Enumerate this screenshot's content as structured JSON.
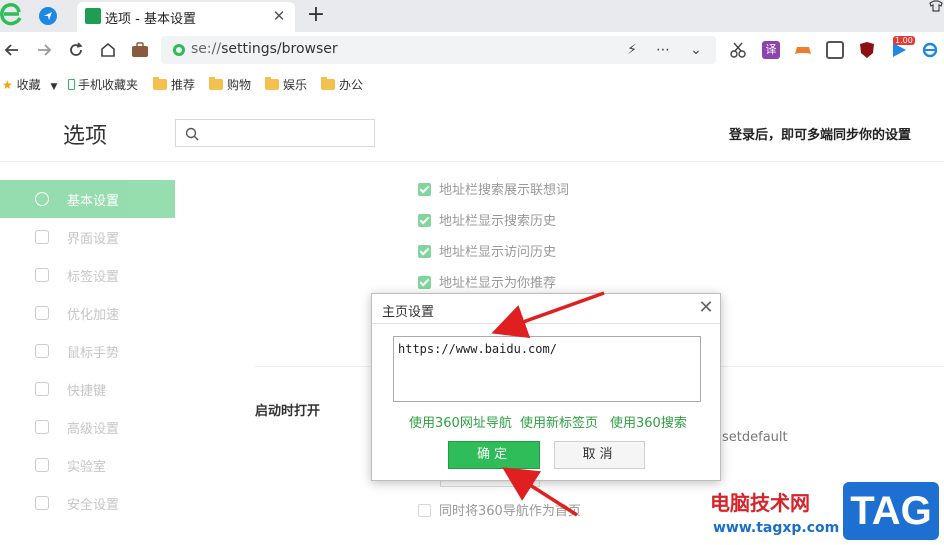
{
  "browser": {
    "tab_title": "选项 - 基本设置",
    "tab_close": "✕",
    "new_tab": "+",
    "url_scheme": "se://",
    "url_path": "settings/browser",
    "omnibox_icons": [
      "lightning-icon",
      "more-icon",
      "chevron-down-icon"
    ],
    "extensions": [
      "scissors-icon",
      "translate-icon",
      "gamepad-icon",
      "reader-icon",
      "ublock-icon",
      "play-icon",
      "ie-icon"
    ],
    "badge": "1.00"
  },
  "bookmarks": {
    "favorites": "收藏",
    "mobile": "手机收藏夹",
    "folders": [
      "推荐",
      "购物",
      "娱乐",
      "办公"
    ]
  },
  "settings": {
    "title": "选项",
    "search_placeholder": "",
    "sync_text": "登录后，即可多端同步你的设置",
    "sidebar": [
      {
        "label": "基本设置",
        "active": true
      },
      {
        "label": "界面设置"
      },
      {
        "label": "标签设置"
      },
      {
        "label": "优化加速"
      },
      {
        "label": "鼠标手势"
      },
      {
        "label": "快捷键"
      },
      {
        "label": "高级设置"
      },
      {
        "label": "实验室"
      },
      {
        "label": "安全设置"
      }
    ],
    "options": [
      {
        "label": "地址栏搜索展示联想词",
        "checked": true
      },
      {
        "label": "地址栏显示搜索历史",
        "checked": true
      },
      {
        "label": "地址栏显示访问历史",
        "checked": true
      },
      {
        "label": "地址栏显示为你推荐",
        "checked": true
      }
    ],
    "startup_section": "启动时打开",
    "frag_text": "setdefault",
    "bottom_option": "同时将360导航作为首页"
  },
  "dialog": {
    "title": "主页设置",
    "close": "✕",
    "url_value": "https://www.baidu.com/",
    "links": [
      "使用360网址导航",
      "使用新标签页",
      "使用360搜索"
    ],
    "ok": "确定",
    "cancel": "取消"
  },
  "watermark": {
    "cn": "电脑技术网",
    "url": "www.tagxp.com",
    "tag": "TAG"
  },
  "colors": {
    "accent": "#2ebd59",
    "annotation_arrow": "#e02020",
    "link": "#2ea043"
  }
}
